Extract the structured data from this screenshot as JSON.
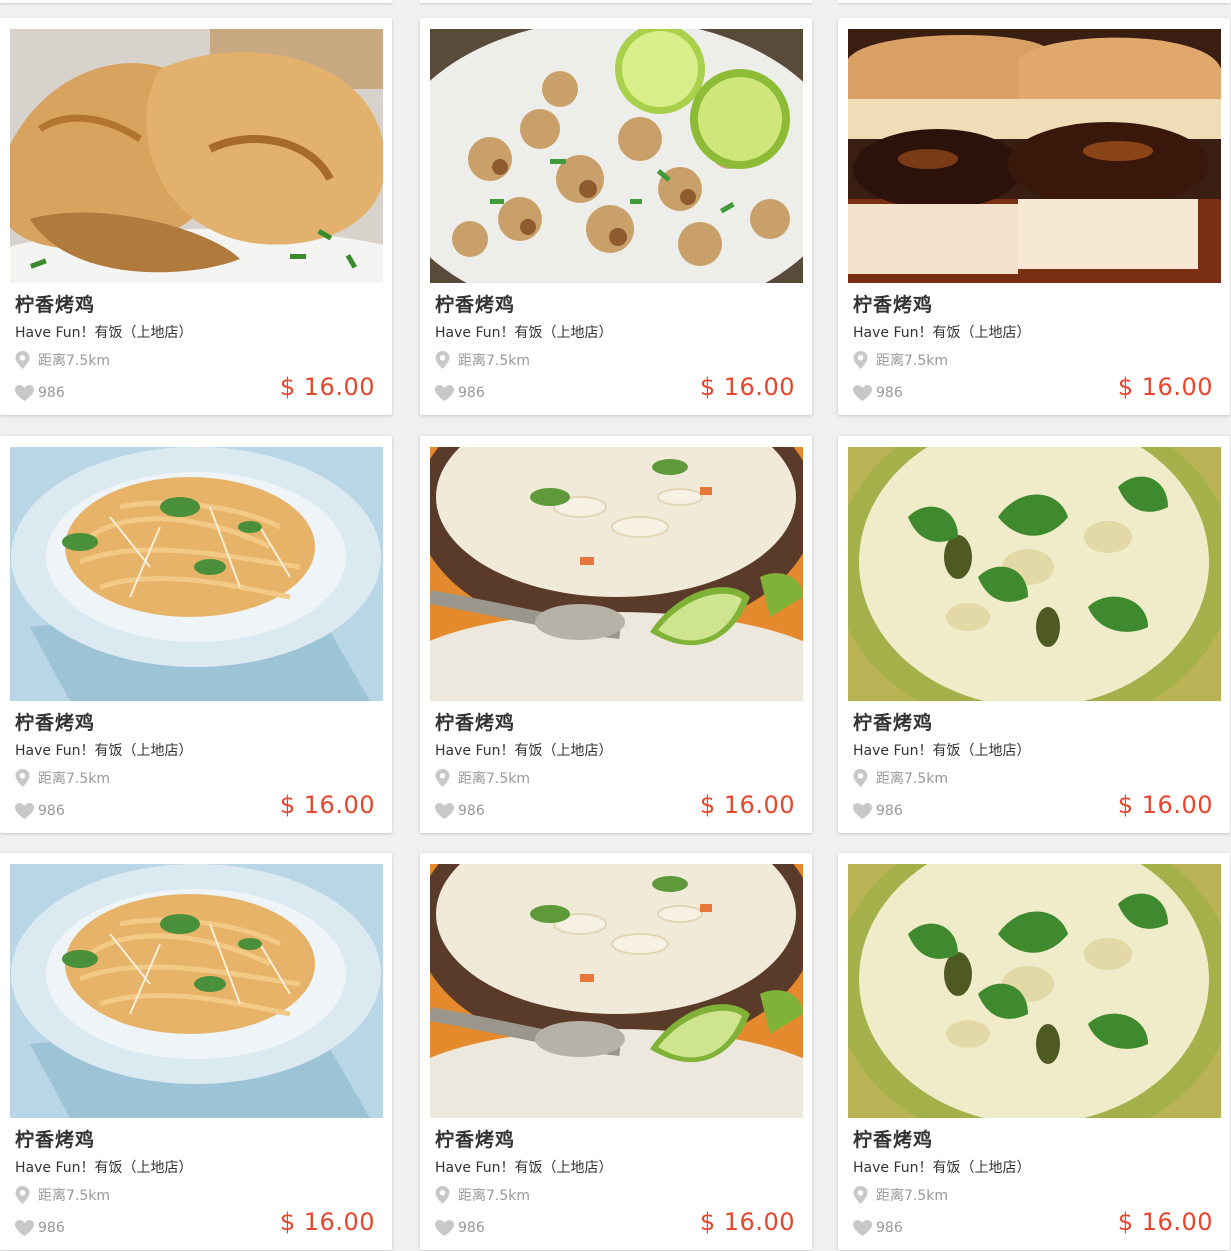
{
  "colors": {
    "price": "#e8462c",
    "icon": "#c8c8c8",
    "text": "#333333",
    "muted": "#999999"
  },
  "icons": {
    "location": "location-pin-icon",
    "likes": "heart-icon"
  },
  "cards": [
    {
      "image": "roast-chicken",
      "title": "柠香烤鸡",
      "shop": "Have Fun！有饭（上地店）",
      "distance": "距离7.5km",
      "likes": "986",
      "price": "$ 16.00"
    },
    {
      "image": "cauliflower-lime",
      "title": "柠香烤鸡",
      "shop": "Have Fun！有饭（上地店）",
      "distance": "距离7.5km",
      "likes": "986",
      "price": "$ 16.00"
    },
    {
      "image": "glazed-sandwich",
      "title": "柠香烤鸡",
      "shop": "Have Fun！有饭（上地店）",
      "distance": "距离7.5km",
      "likes": "986",
      "price": "$ 16.00"
    },
    {
      "image": "noodle-salad",
      "title": "柠香烤鸡",
      "shop": "Have Fun！有饭（上地店）",
      "distance": "距离7.5km",
      "likes": "986",
      "price": "$ 16.00"
    },
    {
      "image": "coconut-soup",
      "title": "柠香烤鸡",
      "shop": "Have Fun！有饭（上地店）",
      "distance": "距离7.5km",
      "likes": "986",
      "price": "$ 16.00"
    },
    {
      "image": "green-curry",
      "title": "柠香烤鸡",
      "shop": "Have Fun！有饭（上地店）",
      "distance": "距离7.5km",
      "likes": "986",
      "price": "$ 16.00"
    },
    {
      "image": "noodle-salad",
      "title": "柠香烤鸡",
      "shop": "Have Fun！有饭（上地店）",
      "distance": "距离7.5km",
      "likes": "986",
      "price": "$ 16.00"
    },
    {
      "image": "coconut-soup",
      "title": "柠香烤鸡",
      "shop": "Have Fun！有饭（上地店）",
      "distance": "距离7.5km",
      "likes": "986",
      "price": "$ 16.00"
    },
    {
      "image": "green-curry",
      "title": "柠香烤鸡",
      "shop": "Have Fun！有饭（上地店）",
      "distance": "距离7.5km",
      "likes": "986",
      "price": "$ 16.00"
    }
  ]
}
